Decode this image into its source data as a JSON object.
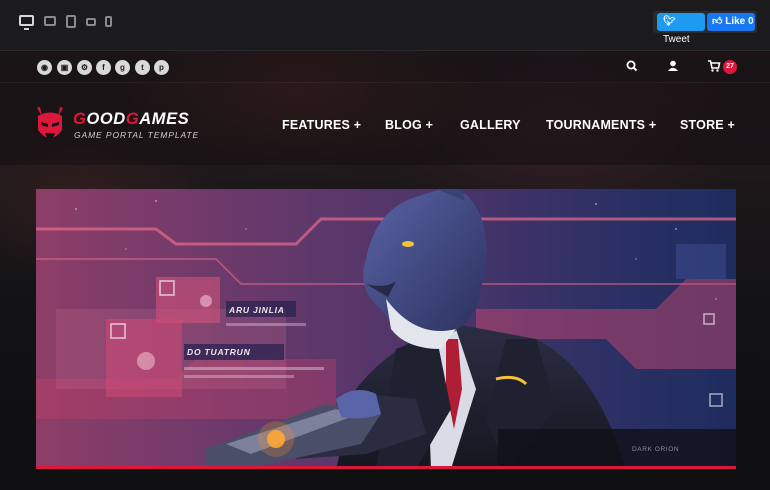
{
  "preview_bar": {
    "devices": [
      "desktop-icon",
      "laptop-icon",
      "tablet-icon",
      "tablet-landscape-icon",
      "phone-icon"
    ],
    "tweet_label": "Tweet",
    "like_label": "Like",
    "like_count": "0"
  },
  "topbar": {
    "social_icons": [
      "rss-icon",
      "twitch-icon",
      "steam-icon",
      "facebook-icon",
      "google-plus-icon",
      "twitter-icon",
      "pinterest-icon"
    ],
    "cart_count": "27"
  },
  "logo": {
    "title_first_letter": "G",
    "title_part1": "OOD",
    "title_second_letter": "G",
    "title_part2": "AMES",
    "subtitle": "GAME PORTAL TEMPLATE"
  },
  "nav": {
    "items": [
      "FEATURES +",
      "BLOG +",
      "GALLERY",
      "TOURNAMENTS +",
      "STORE +"
    ]
  },
  "banner": {
    "hud_label_1": "ARU JINLIA",
    "hud_label_2": "DO TUATRUN",
    "corner_label": "DARK ORION"
  },
  "colors": {
    "accent": "#dd163b",
    "twitter": "#1d9bf0",
    "facebook": "#1877f2",
    "page_bg": "#0e0e10"
  }
}
